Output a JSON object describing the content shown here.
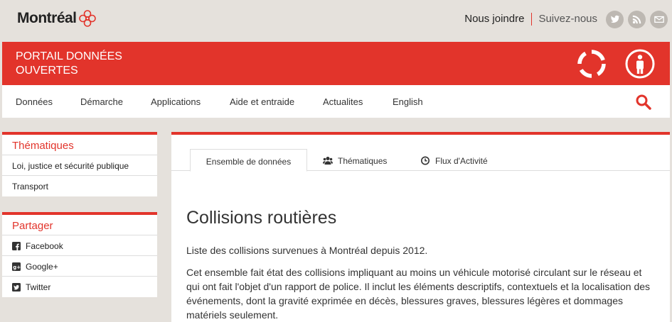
{
  "brand": {
    "logo_text": "Montréal"
  },
  "topbar": {
    "contact_label": "Nous joindre",
    "follow_label": "Suivez-nous",
    "social": [
      "twitter-icon",
      "rss-icon",
      "mail-icon"
    ]
  },
  "header": {
    "title": "PORTAIL DONNÉES OUVERTES"
  },
  "nav": {
    "items": [
      "Données",
      "Démarche",
      "Applications",
      "Aide et entraide",
      "Actualites",
      "English"
    ]
  },
  "sidebar": {
    "thematics": {
      "title": "Thématiques",
      "items": [
        "Loi, justice et sécurité publique",
        "Transport"
      ]
    },
    "share": {
      "title": "Partager",
      "items": [
        {
          "label": "Facebook",
          "icon": "facebook-icon"
        },
        {
          "label": "Google+",
          "icon": "google-plus-icon"
        },
        {
          "label": "Twitter",
          "icon": "twitter-icon"
        }
      ]
    }
  },
  "tabs": [
    {
      "label": "Ensemble de données",
      "active": true
    },
    {
      "label": "Thématiques",
      "icon": "users-icon"
    },
    {
      "label": "Flux d'Activité",
      "icon": "clock-icon"
    }
  ],
  "dataset": {
    "title": "Collisions routières",
    "summary": "Liste des collisions survenues à Montréal depuis 2012.",
    "description": "Cet ensemble fait état des collisions impliquant au moins un véhicule motorisé circulant sur le réseau et qui ont fait l'objet d'un rapport de police. Il inclut les éléments descriptifs, contextuels et la localisation des événements, dont la gravité exprimée en décès, blessures graves, blessures légères et dommages matériels seulement."
  },
  "colors": {
    "accent": "#e2342b",
    "background": "#e5e1dc",
    "social": "#bdb8b2"
  }
}
